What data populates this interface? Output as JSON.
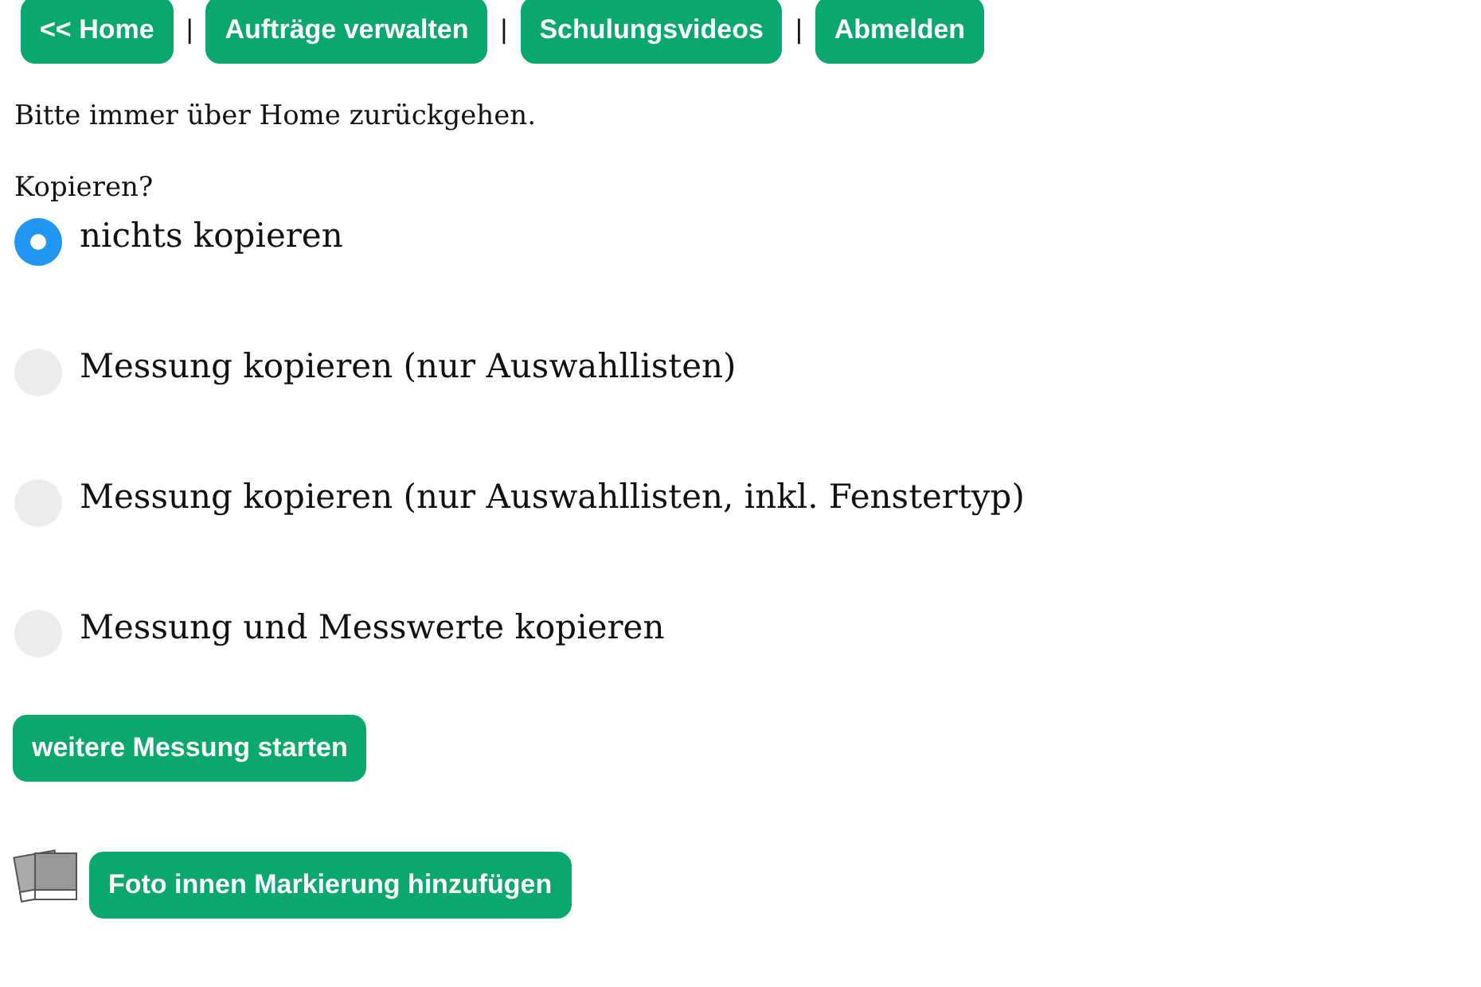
{
  "nav": [
    {
      "label": "<< Home"
    },
    {
      "separator": "|",
      "label": "Aufträge verwalten"
    },
    {
      "separator": "|",
      "label": "Schulungsvideos"
    },
    {
      "separator": "|",
      "label": "Abmelden"
    }
  ],
  "notice": "Bitte immer über Home zurückgehen.",
  "question": "Kopieren?",
  "options": [
    {
      "label": "nichts kopieren",
      "selected": true
    },
    {
      "label": "Messung kopieren (nur Auswahllisten)",
      "selected": false
    },
    {
      "label": "Messung kopieren (nur Auswahllisten, inkl. Fenstertyp)",
      "selected": false
    },
    {
      "label": "Messung und Messwerte kopieren",
      "selected": false
    }
  ],
  "start_button": "weitere Messung starten",
  "photo_button": "Foto innen Markierung hinzufügen"
}
